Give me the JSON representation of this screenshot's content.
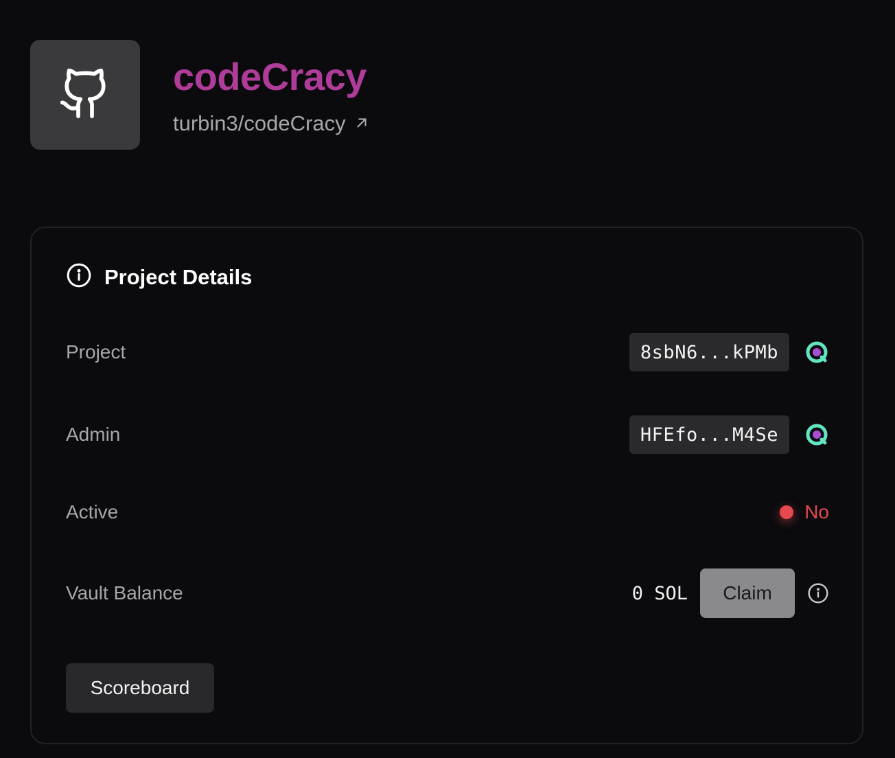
{
  "header": {
    "repo_name": "codeCracy",
    "repo_link": "turbin3/codeCracy",
    "avatar_icon": "github-icon",
    "link_icon": "external-arrow-icon"
  },
  "card": {
    "title": "Project Details",
    "title_icon": "info-icon",
    "rows": {
      "project": {
        "label": "Project",
        "value": "8sbN6...kPMb",
        "icon": "solana-explorer-icon"
      },
      "admin": {
        "label": "Admin",
        "value": "HFEfo...M4Se",
        "icon": "solana-explorer-icon"
      },
      "active": {
        "label": "Active",
        "value": "No",
        "status_color": "#e5484d"
      },
      "vault": {
        "label": "Vault Balance",
        "value": "0 SOL",
        "claim_label": "Claim",
        "info_icon": "info-icon"
      }
    },
    "scoreboard_label": "Scoreboard"
  },
  "colors": {
    "accent_title": "#b03c9a",
    "background": "#0b0b0e",
    "inactive": "#e5484d",
    "explorer_ring": "#62e3c1",
    "explorer_dot": "#a94cd6"
  }
}
